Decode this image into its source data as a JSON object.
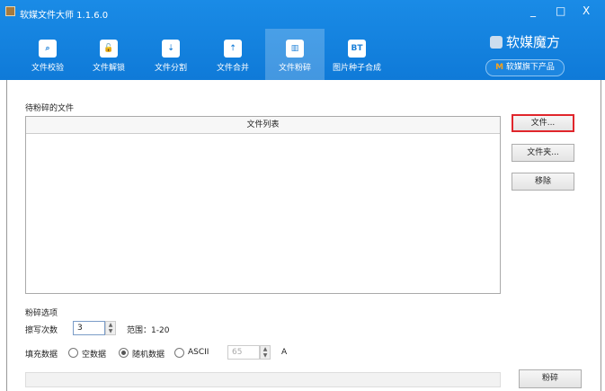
{
  "window": {
    "title": "软媒文件大师 1.1.6.0",
    "minimize": "_",
    "maximize": "□",
    "close": "X"
  },
  "tabs": [
    {
      "label": "文件校验",
      "icon": "magnifier-icon",
      "glyph": "⌕"
    },
    {
      "label": "文件解锁",
      "icon": "unlock-icon",
      "glyph": "🔓"
    },
    {
      "label": "文件分割",
      "icon": "zipper-split-icon",
      "glyph": "⇣"
    },
    {
      "label": "文件合并",
      "icon": "zipper-merge-icon",
      "glyph": "⇡"
    },
    {
      "label": "文件粉碎",
      "icon": "shredder-icon",
      "glyph": "▥",
      "active": true
    },
    {
      "label": "图片种子合成",
      "icon": "bt-icon",
      "glyph": "BT"
    }
  ],
  "brand": {
    "name": "软媒魔方",
    "products_prefix": "M",
    "products": "软媒旗下产品"
  },
  "main": {
    "files_label": "待粉碎的文件",
    "list_header": "文件列表",
    "btn_file": "文件...",
    "btn_folder": "文件夹...",
    "btn_remove": "移除",
    "options_label": "粉碎选项",
    "passes_label": "擦写次数",
    "passes_value": "3",
    "range": "范围：1-20",
    "fill_label": "填充数据",
    "fill_options": [
      "空数据",
      "随机数据",
      "ASCII"
    ],
    "fill_selected": "随机数据",
    "ascii_value": "65",
    "ascii_char": "A",
    "progress": 0,
    "btn_shred": "粉碎"
  }
}
